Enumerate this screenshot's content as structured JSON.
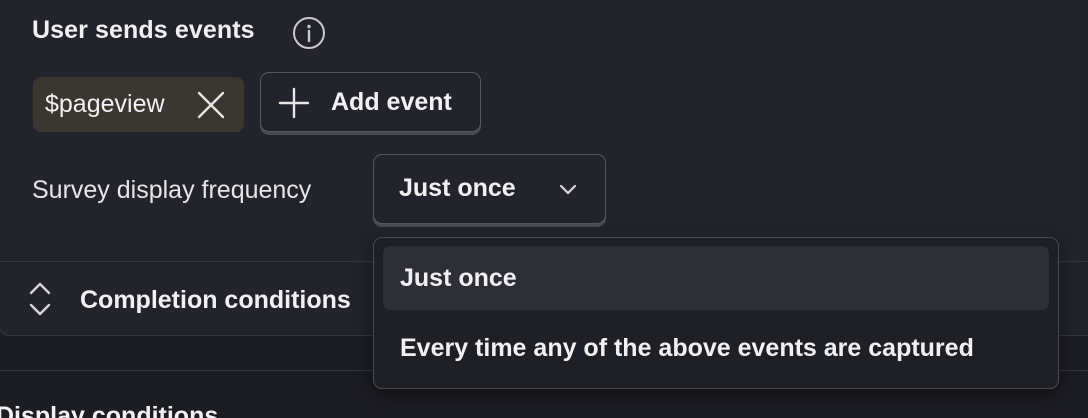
{
  "trigger": {
    "title": "User sends events",
    "info_icon": "info-circle-icon",
    "events": [
      {
        "label": "$pageview",
        "remove_icon": "close-icon"
      }
    ],
    "add_event_label": "Add event",
    "add_event_icon": "plus-icon"
  },
  "frequency": {
    "label": "Survey display frequency",
    "selected": "Just once",
    "dropdown_icon": "chevron-down-icon",
    "options": [
      {
        "label": "Just once",
        "selected": true
      },
      {
        "label": "Every time any of the above events are captured",
        "selected": false
      }
    ]
  },
  "completion": {
    "label": "Completion conditions",
    "toggle_icon": "expand-collapse-icon"
  },
  "next_section": {
    "title": "Display conditions"
  },
  "colors": {
    "background": "#1c1d23",
    "panel": "#23242b",
    "chip": "#3a3630",
    "border": "#55565e",
    "text": "#f1f1f3"
  }
}
